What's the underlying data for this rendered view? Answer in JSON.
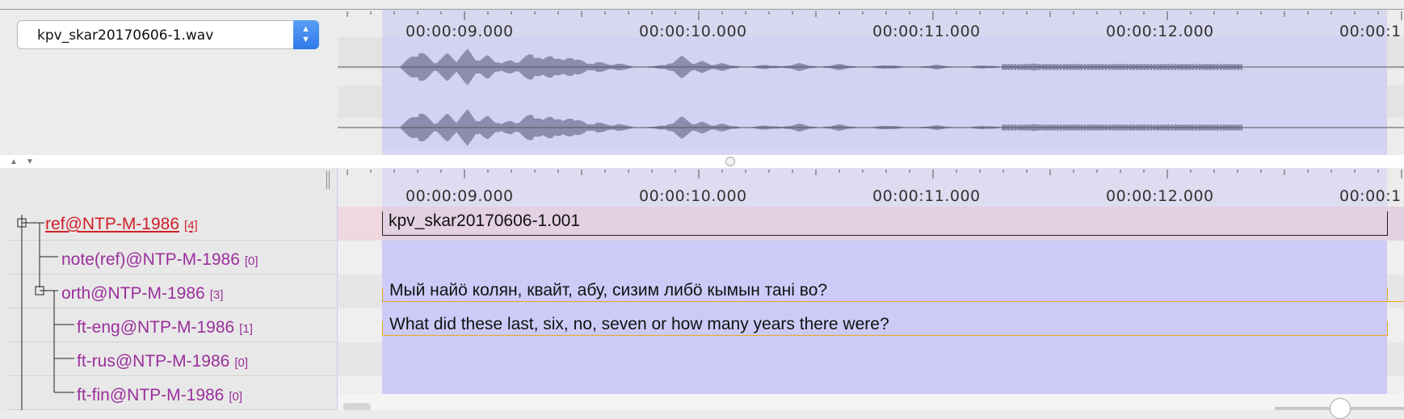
{
  "media": {
    "selected_file": "kpv_skar20170606-1.wav"
  },
  "ruler": {
    "ticks": [
      "00:00:09.000",
      "00:00:10.000",
      "00:00:11.000",
      "00:00:12.000",
      "00:00:1"
    ]
  },
  "tiers": [
    {
      "name": "ref@NTP-M-1986",
      "count": "[4]",
      "active": true
    },
    {
      "name": "note(ref)@NTP-M-1986",
      "count": "[0]",
      "active": false
    },
    {
      "name": "orth@NTP-M-1986",
      "count": "[3]",
      "active": false
    },
    {
      "name": "ft-eng@NTP-M-1986",
      "count": "[1]",
      "active": false
    },
    {
      "name": "ft-rus@NTP-M-1986",
      "count": "[0]",
      "active": false
    },
    {
      "name": "ft-fin@NTP-M-1986",
      "count": "[0]",
      "active": false
    }
  ],
  "annotations": {
    "ref": "kpv_skar20170606-1.001",
    "orth": "Мый найӧ колян, квайт, абу, сизим либӧ кымын тані во?",
    "ft_eng": "What did these last, six, no, seven or how many years there were?"
  },
  "colors": {
    "selection": "#cccbf8",
    "waveform": "#8c8cae",
    "tier_label": "#9b2f9b",
    "active_tier": "#d0202a",
    "annotation_border": "#e8a820"
  }
}
